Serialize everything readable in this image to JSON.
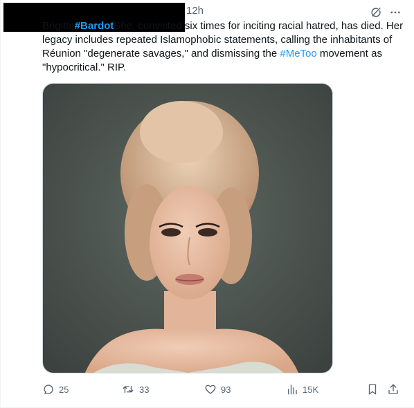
{
  "post": {
    "timestamp": "12h",
    "text_parts": {
      "p1": "Brigitte",
      "hashtag1": "#Bardot",
      "p2": "She, convicted six times for inciting racial hatred, has died. Her legacy includes repeated Islamophobic statements, calling the inhabitants of Réunion \"degenerate savages,\" and dismissing the ",
      "hashtag2": "#MeToo",
      "p3": " movement as \"hypocritical.\" RIP."
    },
    "media": {
      "alt": ""
    }
  },
  "actions": {
    "replies": "25",
    "reposts": "33",
    "likes": "93",
    "views": "15K"
  },
  "icons": {
    "header": [
      "grok-icon",
      "more-icon"
    ],
    "footer": [
      "reply-icon",
      "repost-icon",
      "like-icon",
      "views-icon",
      "bookmark-icon",
      "share-icon"
    ]
  },
  "colors": {
    "accent": "#1d9bf0",
    "text": "#0f1419",
    "muted": "#536471",
    "border": "#cfd9de"
  }
}
